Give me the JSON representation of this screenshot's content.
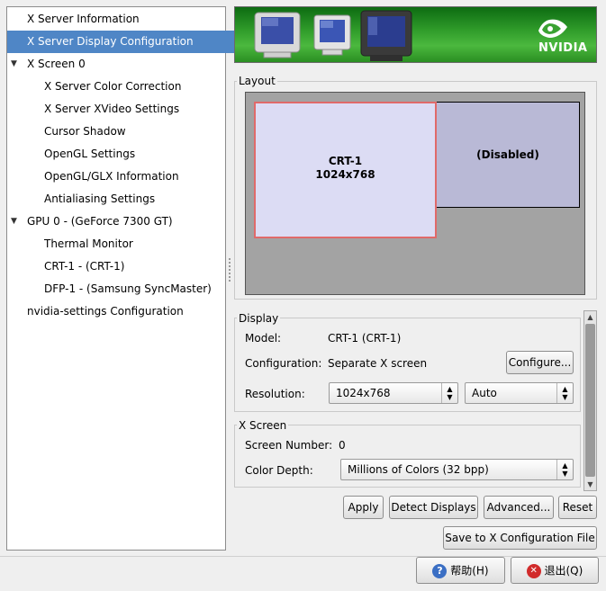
{
  "sidebar": {
    "items": [
      {
        "label": "X Server Information",
        "selected": false
      },
      {
        "label": "X Server Display Configuration",
        "selected": true
      },
      {
        "label": "X Screen 0",
        "expander": "▼"
      },
      {
        "label": "X Server Color Correction"
      },
      {
        "label": "X Server XVideo Settings"
      },
      {
        "label": "Cursor Shadow"
      },
      {
        "label": "OpenGL Settings"
      },
      {
        "label": "OpenGL/GLX Information"
      },
      {
        "label": "Antialiasing Settings"
      },
      {
        "label": "GPU 0 - (GeForce 7300 GT)",
        "expander": "▼"
      },
      {
        "label": "Thermal Monitor"
      },
      {
        "label": "CRT-1 - (CRT-1)"
      },
      {
        "label": "DFP-1 - (Samsung SyncMaster)"
      },
      {
        "label": "nvidia-settings Configuration"
      }
    ]
  },
  "banner": {
    "logo_text": "NVIDIA"
  },
  "layout": {
    "label": "Layout",
    "display1": {
      "name": "CRT-1",
      "mode": "1024x768"
    },
    "display2": {
      "name": "(Disabled)"
    }
  },
  "display": {
    "label": "Display",
    "model_label": "Model:",
    "model_value": "CRT-1 (CRT-1)",
    "config_label": "Configuration:",
    "config_value": "Separate X screen",
    "configure_button": "Configure...",
    "resolution_label": "Resolution:",
    "resolution_value": "1024x768",
    "refresh_value": "Auto"
  },
  "xscreen": {
    "label": "X Screen",
    "number_label": "Screen Number:",
    "number_value": "0",
    "depth_label": "Color Depth:",
    "depth_value": "Millions of Colors (32 bpp)"
  },
  "actions": {
    "apply": "Apply",
    "detect": "Detect Displays",
    "advanced": "Advanced...",
    "reset": "Reset",
    "save": "Save to X Configuration File"
  },
  "footer": {
    "help": "帮助(H)",
    "quit": "退出(Q)"
  },
  "colors": {
    "selection": "#4f86c6",
    "banner_green": "#2e9a29",
    "display_active": "#dcdcf4",
    "display_active_border": "#e06a6a",
    "display_disabled": "#b9b9d6"
  }
}
